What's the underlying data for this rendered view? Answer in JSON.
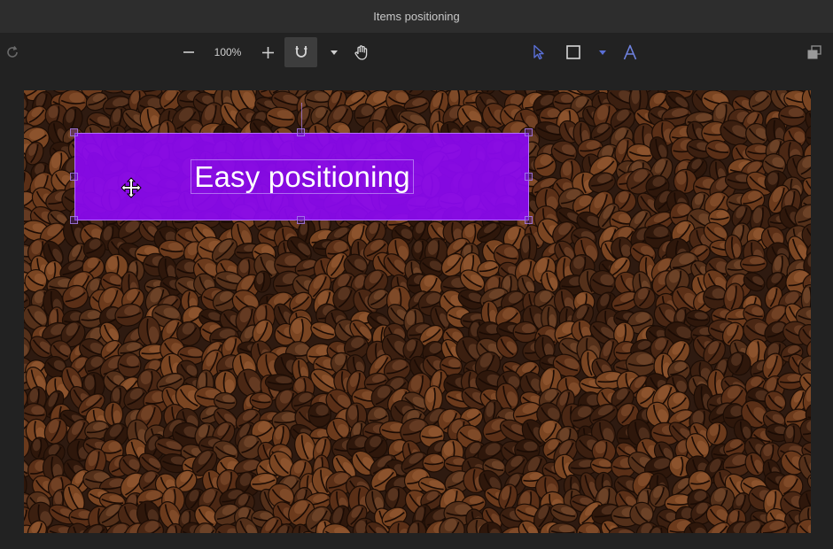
{
  "window": {
    "title": "Items positioning"
  },
  "toolbar": {
    "zoom_level": "100%",
    "icons": [
      "redo-icon",
      "zoom-out-icon",
      "zoom-in-icon",
      "magnet-snap-icon",
      "chevron-down-icon",
      "hand-pan-icon",
      "pointer-select-icon",
      "rectangle-icon",
      "chevron-down-icon",
      "text-tool-icon",
      "layers-arrange-icon"
    ]
  },
  "canvas": {
    "banner": {
      "text": "Easy positioning",
      "fill_color": "#8a0aee"
    },
    "background_image": "coffee-beans"
  },
  "colors": {
    "accent": "#8a0aee",
    "titlebar": "#2d2d2d",
    "app_bg": "#222222"
  }
}
